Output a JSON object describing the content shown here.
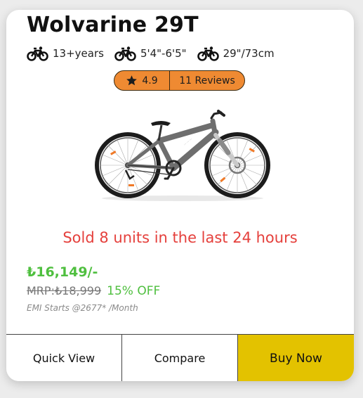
{
  "product": {
    "title": "Wolvarine 29T",
    "specs": [
      {
        "icon": "bicycle-icon",
        "text": "13+years"
      },
      {
        "icon": "bicycle-icon",
        "text": "5'4\"-6'5\""
      },
      {
        "icon": "bicycle-icon",
        "text": "29\"/73cm"
      }
    ],
    "rating": {
      "score": "4.9",
      "reviews": "11 Reviews",
      "icon": "star-icon"
    },
    "image": {
      "icon": "bicycle-image"
    },
    "sold_text": "Sold 8 units in the last 24 hours",
    "price": "₺16,149/-",
    "mrp": "MRP:₺18,999",
    "discount": "15% OFF",
    "emi": "EMI Starts @2677* /Month"
  },
  "actions": {
    "quick_view": "Quick View",
    "compare": "Compare",
    "buy_now": "Buy Now"
  },
  "colors": {
    "rating_bg": "#ef8a32",
    "sold": "#e5403c",
    "price": "#4fbf3f",
    "buy_button": "#e3c200"
  }
}
